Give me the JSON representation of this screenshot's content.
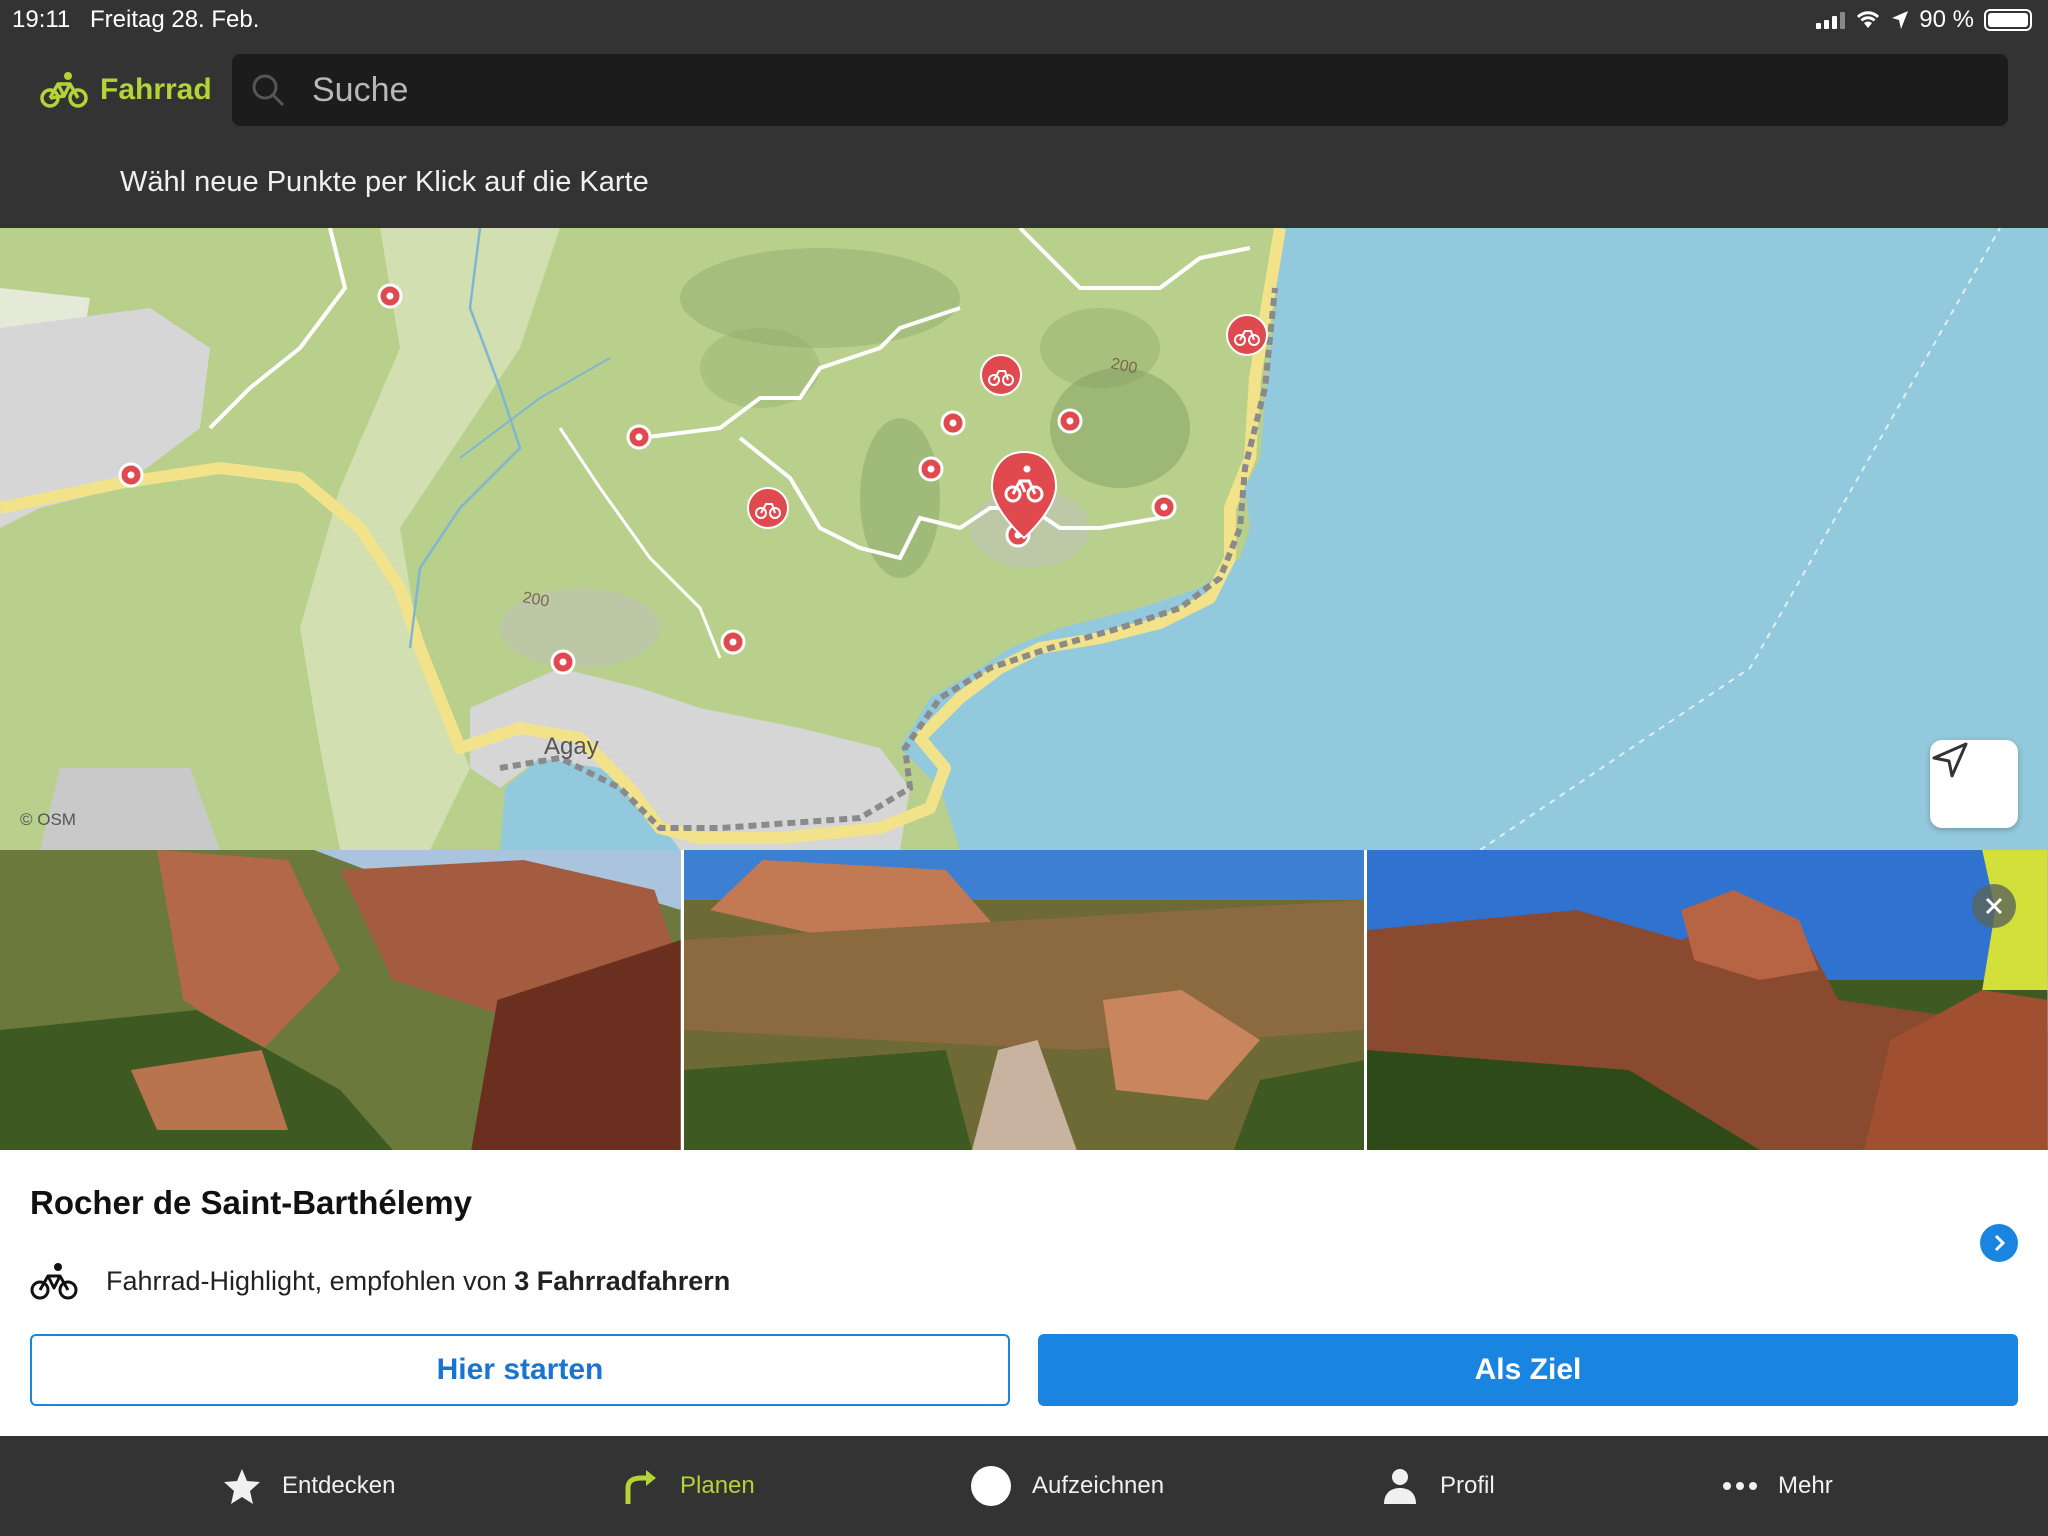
{
  "status": {
    "time": "19:11",
    "date": "Freitag 28. Feb.",
    "battery": "90 %",
    "battery_level": 0.9
  },
  "header": {
    "sport_label": "Fahrrad",
    "search_placeholder": "Suche",
    "hint": "Wähl neue Punkte per Klick auf die Karte"
  },
  "map": {
    "town_label": "Agay",
    "contour_labels": [
      "200",
      "200"
    ],
    "attribution": "© OSM"
  },
  "highlight": {
    "title": "Rocher de Saint-Barthélemy",
    "description_prefix": "Fahrrad-Highlight, empfohlen von ",
    "description_bold": "3 Fahrradfahrern",
    "start_button": "Hier starten",
    "destination_button": "Als Ziel"
  },
  "tabs": [
    {
      "label": "Entdecken",
      "icon": "star-icon",
      "active": false
    },
    {
      "label": "Planen",
      "icon": "route-arrow-icon",
      "active": true
    },
    {
      "label": "Aufzeichnen",
      "icon": "record-circle-icon",
      "active": false
    },
    {
      "label": "Profil",
      "icon": "person-icon",
      "active": false
    },
    {
      "label": "Mehr",
      "icon": "more-dots-icon",
      "active": false
    }
  ],
  "colors": {
    "accent_green": "#b4d336",
    "primary_blue": "#1a85e0",
    "marker_red": "#e04a4f",
    "sea": "#93c9dc",
    "land": "#b8d08c"
  }
}
